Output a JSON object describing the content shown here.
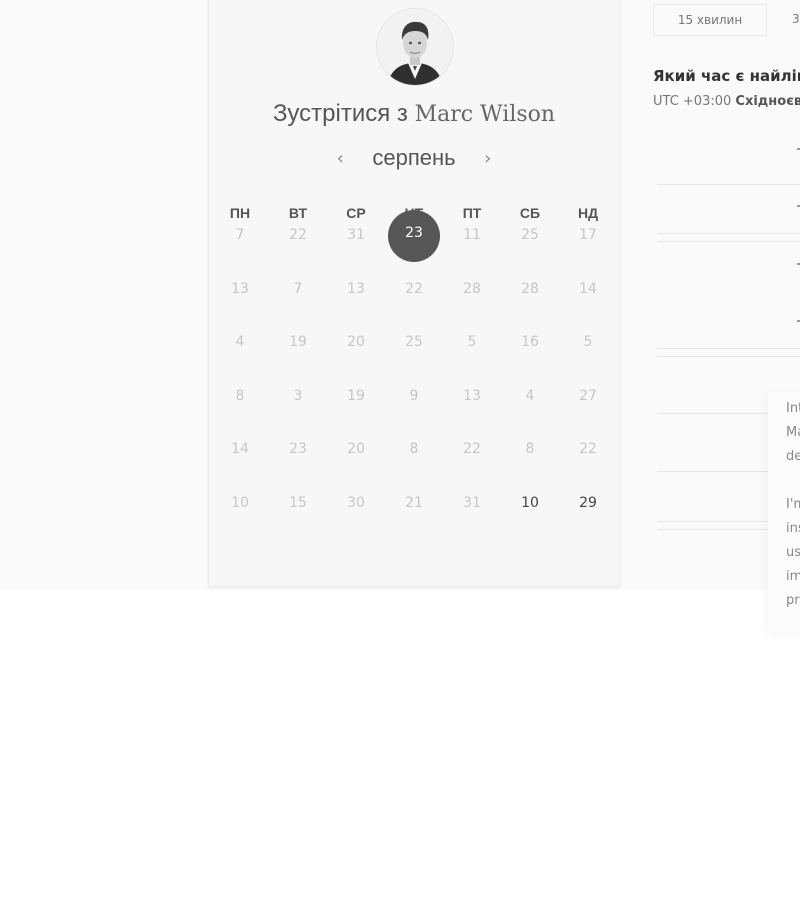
{
  "host": {
    "title_prefix": "Зустрітися з",
    "name": "Marc Wilson"
  },
  "calendar": {
    "month": "серпень",
    "prev_symbol": "‹",
    "next_symbol": "›",
    "weekdays": [
      "ПН",
      "ВТ",
      "СР",
      "ЧТ",
      "ПТ",
      "СБ",
      "НД"
    ],
    "weeks": [
      [
        "7",
        "22",
        "31",
        "23",
        "11",
        "25",
        "17"
      ],
      [
        "13",
        "7",
        "13",
        "22",
        "28",
        "28",
        "14"
      ],
      [
        "4",
        "19",
        "20",
        "25",
        "5",
        "16",
        "5"
      ],
      [
        "8",
        "3",
        "19",
        "9",
        "13",
        "4",
        "27"
      ],
      [
        "14",
        "23",
        "20",
        "8",
        "22",
        "8",
        "22"
      ],
      [
        "10",
        "15",
        "30",
        "21",
        "31",
        "10",
        "29"
      ]
    ],
    "selected_day": "23",
    "available_days": [
      "10",
      "29"
    ]
  },
  "duration": {
    "option_1": "15 хвилин",
    "option_2": "3"
  },
  "schedule": {
    "question": "Який час є найліпш",
    "timezone_offset": "UTC +03:00",
    "timezone_name": "Східноєв"
  },
  "info": {
    "lines": [
      "Int",
      "Ma",
      "de",
      "",
      "I'm",
      "ins",
      "us",
      "im",
      "pr"
    ]
  }
}
